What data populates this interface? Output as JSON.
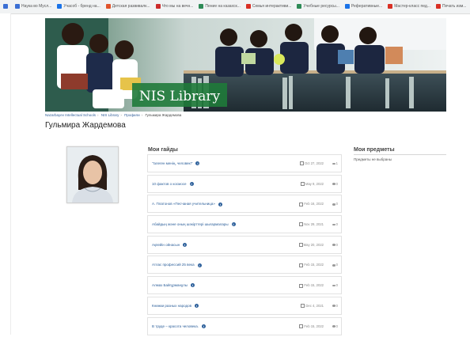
{
  "bookmarks": [
    {
      "label": "",
      "color": "#3b6fd4"
    },
    {
      "label": "Наука во Мусл...",
      "color": "#3b6fd4"
    },
    {
      "label": "Учасоб - бренд на...",
      "color": "#1a73e8"
    },
    {
      "label": "Детская развивалк...",
      "color": "#e0542c"
    },
    {
      "label": "Что мы на вечн...",
      "color": "#cc2b2b"
    },
    {
      "label": "Пение на казахск...",
      "color": "#2e8b57"
    },
    {
      "label": "Семья интерактиви...",
      "color": "#d93025"
    },
    {
      "label": "Учебные ресурсы...",
      "color": "#2e8b57"
    },
    {
      "label": "Реферативные...",
      "color": "#1a73e8"
    },
    {
      "label": "Мастер-класс пед...",
      "color": "#d93025"
    },
    {
      "label": "Печать изм...",
      "color": "#d93025"
    }
  ],
  "banner": {
    "title": "NIS Library"
  },
  "breadcrumb": [
    "Nazarbayev Intellectual Schools",
    "NIS Library",
    "Профили",
    "Гульмира Жардемова"
  ],
  "profile": {
    "name": "Гульмира Жардемова"
  },
  "guides": {
    "heading": "Мои гайды",
    "items": [
      {
        "title": "\"Ізлеген менің, человек!\"",
        "date": "Oct 27, 2022",
        "views": "1"
      },
      {
        "title": "10 фактов о космосе",
        "date": "May 9, 2022",
        "views": "0"
      },
      {
        "title": "А. Платонов «Песчаная учительница»",
        "date": "Feb 16, 2022",
        "views": "0"
      },
      {
        "title": "Абайдың және оның шәкірттері шығармалары",
        "date": "Nov 29, 2021",
        "views": "0"
      },
      {
        "title": "Ақпейін ойнасын",
        "date": "May 20, 2022",
        "views": "0"
      },
      {
        "title": "Атлас профессий 25 века",
        "date": "Feb 15, 2022",
        "views": "0"
      },
      {
        "title": "Алмаз Байгұрманұлы",
        "date": "Feb 15, 2022",
        "views": "0"
      },
      {
        "title": "Книжки разных народов",
        "date": "Dec 4, 2021",
        "views": "0"
      },
      {
        "title": "В труде – красота человека.",
        "date": "Feb 15, 2022",
        "views": "0"
      }
    ]
  },
  "subjects": {
    "heading": "Мои предметы",
    "empty": "Предметы не выбраны"
  }
}
